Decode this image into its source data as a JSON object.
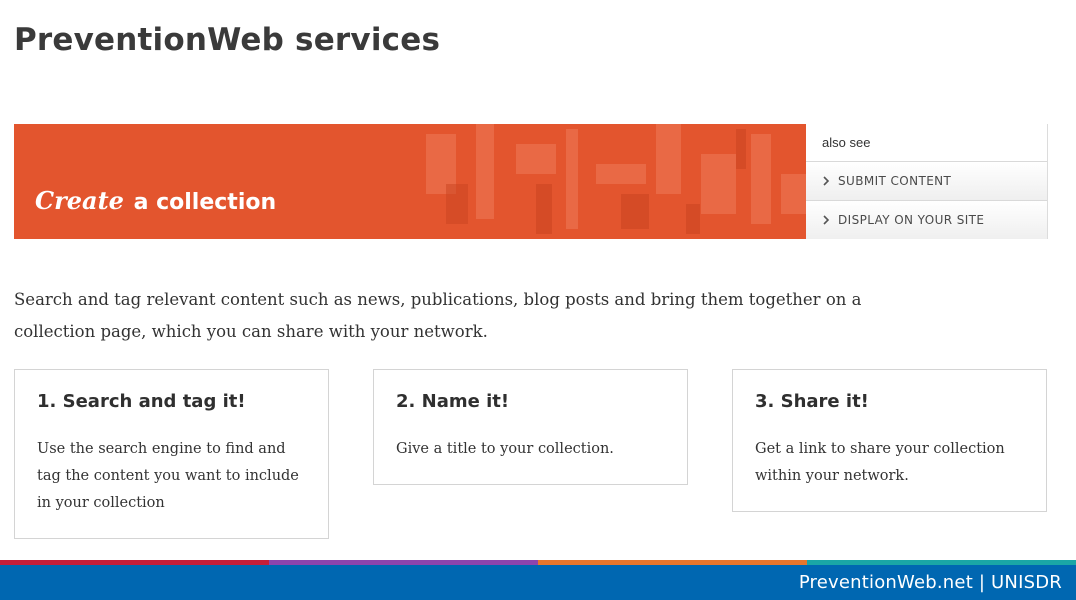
{
  "page": {
    "title": "PreventionWeb services"
  },
  "banner": {
    "emphasis": "Create",
    "rest": "a collection",
    "color": "#e3552e"
  },
  "also_see": {
    "title": "also see",
    "links": [
      {
        "label": "SUBMIT CONTENT",
        "icon": "chevron-right-icon"
      },
      {
        "label": "DISPLAY ON YOUR SITE",
        "icon": "chevron-right-icon"
      }
    ]
  },
  "intro": "Search and tag relevant content such as news, publications, blog posts and bring them together on a collection page, which you can share with your network.",
  "steps": [
    {
      "title": "1. Search and tag it!",
      "text": "Use the search engine to find and tag the content you want to include in your collection"
    },
    {
      "title": "2. Name it!",
      "text": "Give a title to your collection."
    },
    {
      "title": "3. Share it!",
      "text": "Get a link to share your collection within your network."
    }
  ],
  "footer": {
    "text": "PreventionWeb.net | UNISDR",
    "color": "#0067b1"
  },
  "stripe_colors": [
    "#c41e3a",
    "#8e44ad",
    "#e8762c",
    "#1aa6a6"
  ]
}
